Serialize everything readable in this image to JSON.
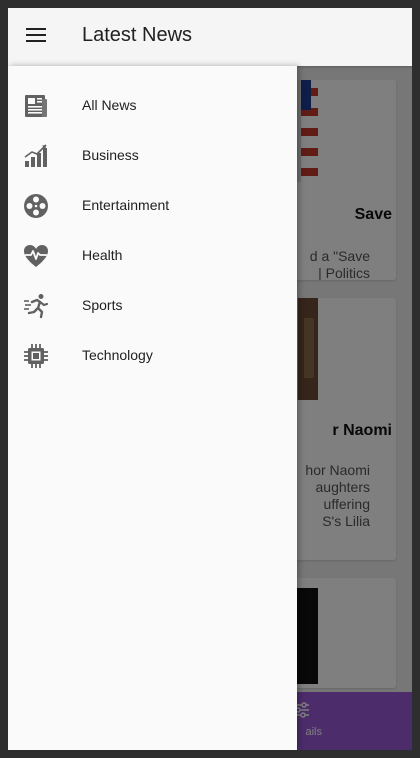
{
  "app_bar": {
    "title": "Latest News",
    "menu_icon": "hamburger-menu-icon"
  },
  "drawer": {
    "items": [
      {
        "label": "All News",
        "icon": "newspaper-icon"
      },
      {
        "label": "Business",
        "icon": "bar-chart-icon"
      },
      {
        "label": "Entertainment",
        "icon": "film-reel-icon"
      },
      {
        "label": "Health",
        "icon": "heartbeat-icon"
      },
      {
        "label": "Sports",
        "icon": "running-person-icon"
      },
      {
        "label": "Technology",
        "icon": "chip-icon"
      }
    ]
  },
  "background": {
    "cards": [
      {
        "title": "Save",
        "description_lines": [
          "d a \"Save",
          "| Politics"
        ]
      },
      {
        "title": "r Naomi",
        "description_lines": [
          "hor Naomi",
          "aughters",
          "uffering",
          "S's Lilia"
        ]
      }
    ],
    "bottom_bar": {
      "label": "ails",
      "icon": "sliders-icon"
    }
  },
  "colors": {
    "accent": "#9b59d6",
    "drawer_bg": "#fafafa",
    "icon_gray": "#616161"
  }
}
